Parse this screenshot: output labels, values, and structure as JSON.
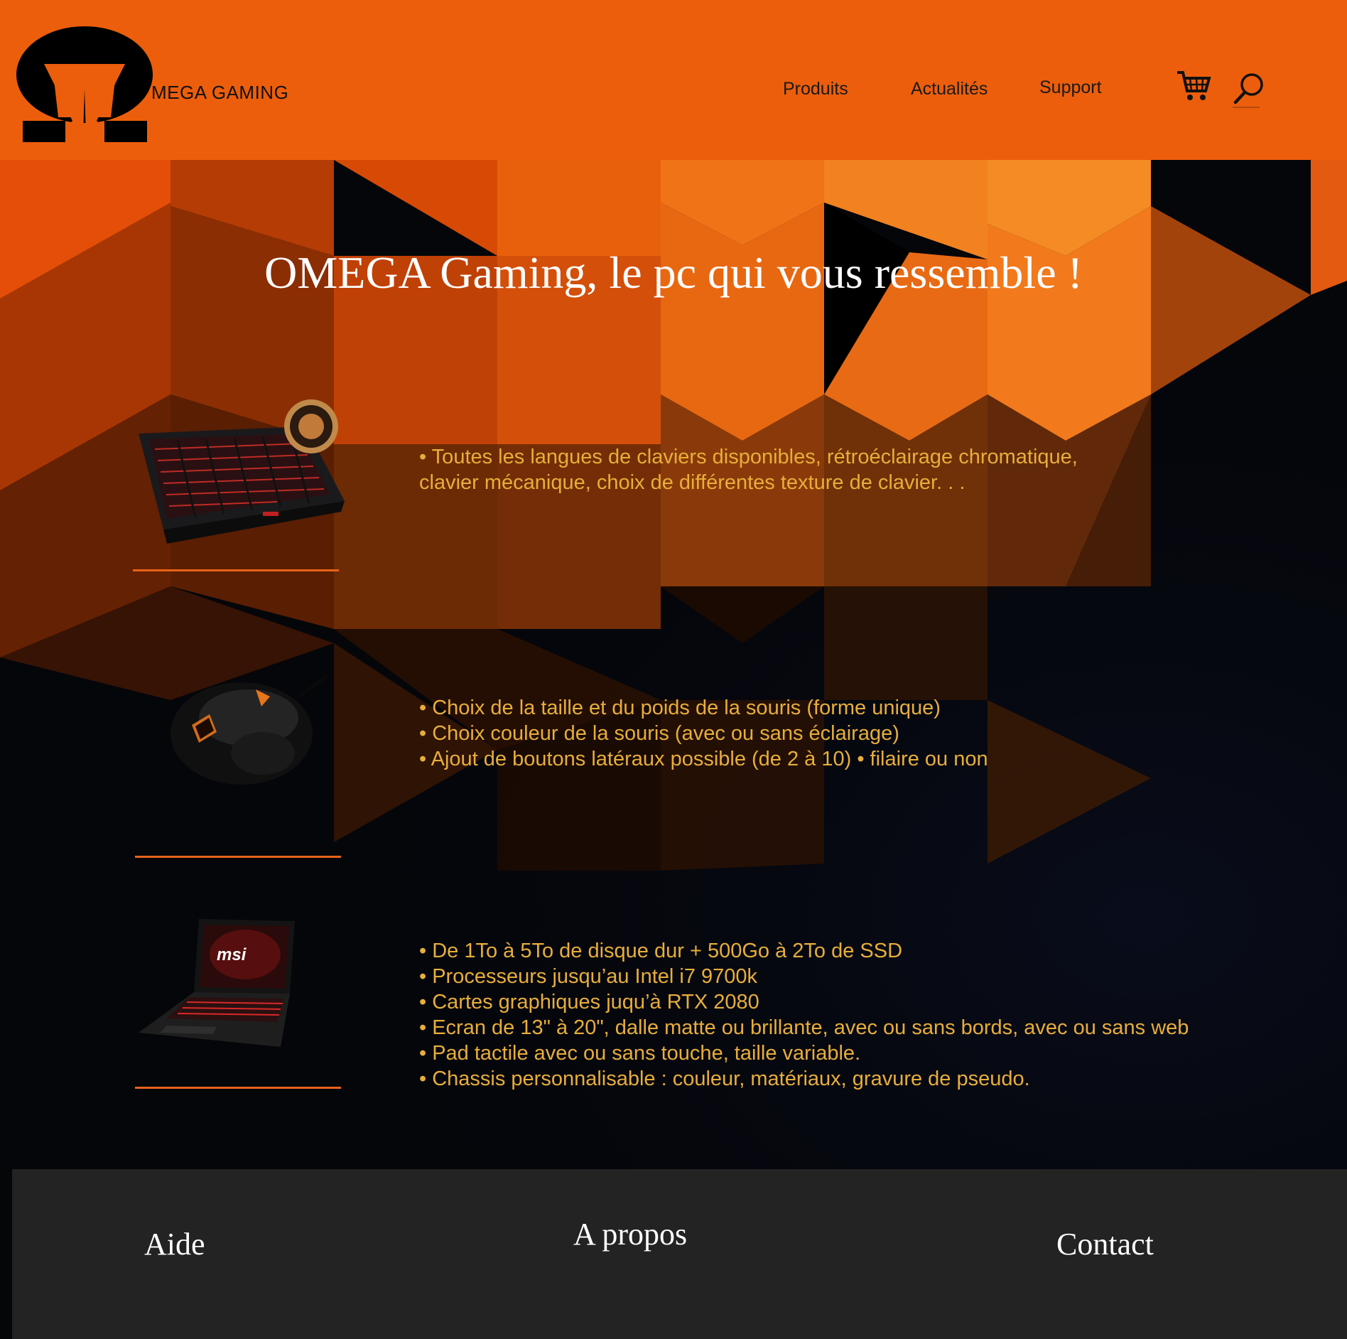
{
  "header": {
    "brand": "MEGA GAMING",
    "nav": [
      {
        "label": "Produits"
      },
      {
        "label": "Actualités"
      },
      {
        "label": "Support"
      }
    ],
    "icons": [
      "cart-icon",
      "search-icon"
    ],
    "background": "#ec5e0c"
  },
  "hero": {
    "title": "OMEGA Gaming, le pc  qui vous ressemble  !"
  },
  "features": [
    {
      "image": "keyboard-image",
      "lines": [
        "• Toutes les langues de claviers disponibles, rétroéclairage chromatique,",
        "clavier mécanique, choix de différentes texture de clavier. . ."
      ]
    },
    {
      "image": "mouse-image",
      "lines": [
        "• Choix de la taille et du poids de la souris (forme unique)",
        "• Choix couleur de la souris (avec ou sans éclairage)",
        "• Ajout de boutons latéraux possible (de 2 à 10) • filaire ou non"
      ]
    },
    {
      "image": "laptop-image",
      "laptop_brand": "msi",
      "lines": [
        "• De 1To à 5To de disque dur + 500Go à 2To de SSD",
        "• Processeurs jusqu’au Intel i7 9700k",
        "• Cartes graphiques juqu’à RTX 2080",
        "• Ecran de 13\" à 20\", dalle matte ou brillante, avec ou sans bords, avec ou sans web",
        "• Pad tactile avec ou sans touche, taille variable.",
        "• Chassis personnalisable : couleur, matériaux, gravure de pseudo."
      ]
    }
  ],
  "footer": {
    "links": [
      {
        "label": "Aide"
      },
      {
        "label": "A propos"
      },
      {
        "label": "Contact"
      }
    ]
  },
  "colors": {
    "accent": "#ec5e0c",
    "feature_text": "#e8ae3a",
    "divider": "#e8621a",
    "footer_bg": "#232323"
  }
}
